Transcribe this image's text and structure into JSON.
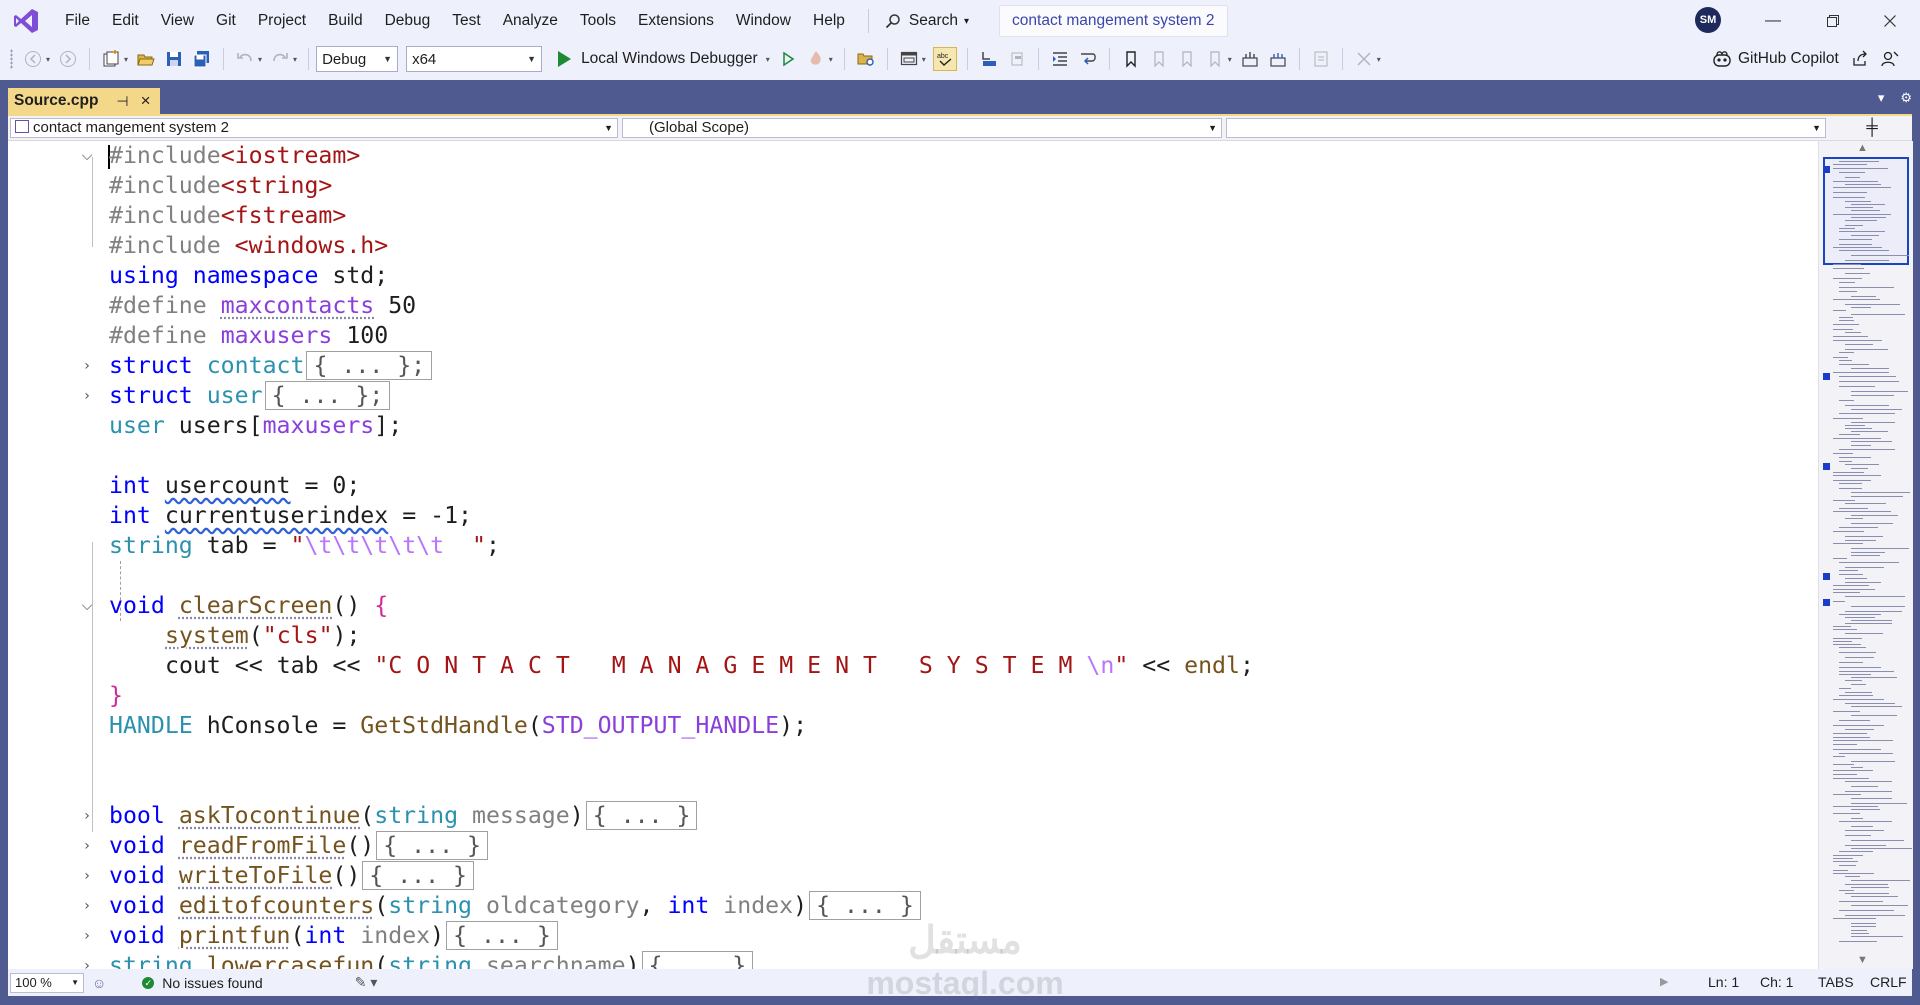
{
  "menu": [
    "File",
    "Edit",
    "View",
    "Git",
    "Project",
    "Build",
    "Debug",
    "Test",
    "Analyze",
    "Tools",
    "Extensions",
    "Window",
    "Help"
  ],
  "search_label": "Search",
  "solution_title": "contact mangement system 2",
  "user_initials": "SM",
  "toolbar": {
    "config": "Debug",
    "platform": "x64",
    "run_label": "Local Windows Debugger",
    "copilot_label": "GitHub Copilot"
  },
  "document_tab": {
    "title": "Source.cpp"
  },
  "nav": {
    "project": "contact mangement system 2",
    "scope": "(Global Scope)",
    "member": ""
  },
  "code": {
    "l1": {
      "pre": "#include",
      "str": "<iostream>"
    },
    "l2": {
      "pre": "#include",
      "str": "<string>"
    },
    "l3": {
      "pre": "#include",
      "str": "<fstream>"
    },
    "l4": {
      "pre": "#include ",
      "str": "<windows.h>"
    },
    "l5": {
      "kw1": "using",
      "kw2": "namespace",
      "rest": " std;"
    },
    "l6": {
      "pre": "#define ",
      "macro": "maxcontacts",
      "num": " 50"
    },
    "l7": {
      "pre": "#define ",
      "macro": "maxusers",
      "num": " 100"
    },
    "l8": {
      "kw": "struct",
      "name": " contact",
      "collapsed": "{ ... };"
    },
    "l9": {
      "kw": "struct",
      "name": " user",
      "collapsed": "{ ... };"
    },
    "l10": {
      "type": "user",
      "var": " users[",
      "macro": "maxusers",
      "end": "];"
    },
    "l12": {
      "kw": "int",
      "var": "usercount",
      "rest": " = 0;"
    },
    "l13": {
      "kw": "int",
      "var": "currentuserindex",
      "rest": " = -1;"
    },
    "l14": {
      "type": "string",
      "var": " tab",
      "op": " = ",
      "q1": "\"",
      "esc": "\\t\\t\\t\\t\\t",
      "sp": "  ",
      "q2": "\"",
      "end": ";"
    },
    "l16": {
      "kw": "void",
      "fn": "clearScreen",
      "paren": "()",
      "brace": "{"
    },
    "l17": {
      "fn": "system",
      "open": "(",
      "str": "\"cls\"",
      "close": ");"
    },
    "l18": {
      "var": "cout",
      "op1": " << ",
      "tab": "tab",
      "op2": " << ",
      "str": "\"C O N T A C T   M A N A G E M E N T   S Y S T E M ",
      "esc": "\\n",
      "strend": "\"",
      "op3": " << ",
      "endl": "endl",
      "end": ";"
    },
    "l19": {
      "brace": "}"
    },
    "l20": {
      "type": "HANDLE",
      "var": " hConsole",
      "op": " = ",
      "fn": "GetStdHandle",
      "open": "(",
      "macro": "STD_OUTPUT_HANDLE",
      "close": ");"
    },
    "l23": {
      "kw": "bool",
      "fn": "askTocontinue",
      "open": "(",
      "ptype": "string",
      "param": " message",
      "close": ")",
      "collapsed": "{ ... }"
    },
    "l24": {
      "kw": "void",
      "fn": "readFromFile",
      "paren": "()",
      "collapsed": "{ ... }"
    },
    "l25": {
      "kw": "void",
      "fn": "writeToFile",
      "paren": "()",
      "collapsed": "{ ... }"
    },
    "l26": {
      "kw": "void",
      "fn": "editofcounters",
      "open": "(",
      "ptype": "string",
      "param": " oldcategory",
      "comma": ", ",
      "ptype2": "int",
      "param2": " index",
      "close": ")",
      "collapsed": "{ ... }"
    },
    "l27": {
      "kw": "void",
      "fn": "printfun",
      "open": "(",
      "ptype": "int",
      "param": " index",
      "close": ")",
      "collapsed": "{ ... }"
    },
    "l28": {
      "type": "string",
      "fn": "lowercasefun",
      "open": "(",
      "ptype": "string",
      "param": " searchname",
      "close": ")",
      "collapsed": "{ ... }"
    }
  },
  "status": {
    "zoom": "100 %",
    "issues": "No issues found",
    "line": "Ln: 1",
    "col": "Ch: 1",
    "tabs": "TABS",
    "eol": "CRLF"
  },
  "watermark": {
    "arabic": "مستقل",
    "latin": "mostaql.com"
  },
  "colors": {
    "accent": "#4f5a91",
    "tab_active": "#f4d88a",
    "keyword": "#0000ff",
    "string": "#a31515"
  }
}
